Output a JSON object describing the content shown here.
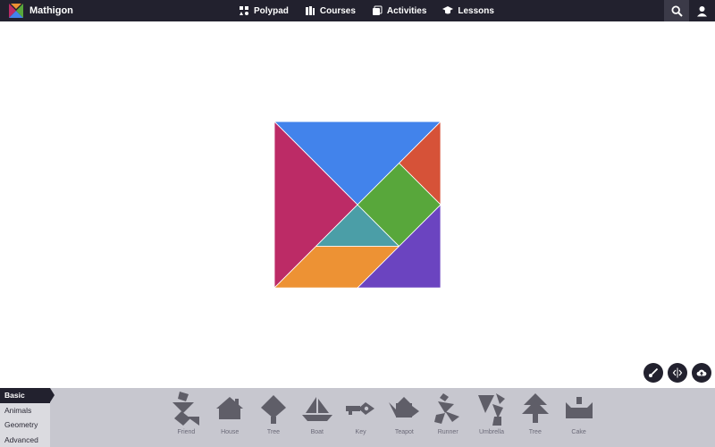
{
  "app": {
    "name": "Mathigon"
  },
  "nav": [
    {
      "label": "Polypad",
      "icon": "polypad-icon"
    },
    {
      "label": "Courses",
      "icon": "courses-icon"
    },
    {
      "label": "Activities",
      "icon": "activities-icon"
    },
    {
      "label": "Lessons",
      "icon": "lessons-icon"
    }
  ],
  "colors": {
    "topbar": "#22212e",
    "blue": "#4283eb",
    "red": "#d65238",
    "magenta": "#bc2b66",
    "green": "#58a73b",
    "teal": "#4b9ea7",
    "orange": "#ed9234",
    "purple": "#6b44c0",
    "silhouette": "#5f5e68"
  },
  "categories": [
    "Basic",
    "Animals",
    "Geometry",
    "Advanced"
  ],
  "active_category": "Basic",
  "shapes": [
    "Friend",
    "House",
    "Tree",
    "Boat",
    "Key",
    "Teapot",
    "Runner",
    "Umbrella",
    "Tree",
    "Cake"
  ]
}
